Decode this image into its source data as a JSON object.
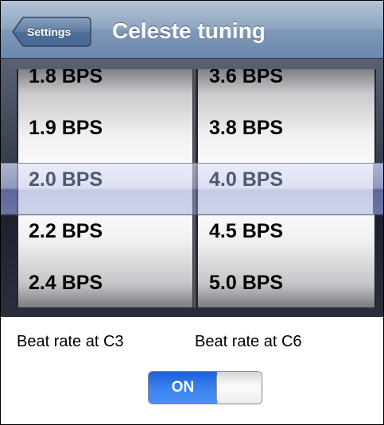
{
  "navbar": {
    "back_label": "Settings",
    "title": "Celeste tuning"
  },
  "picker": {
    "left_column": {
      "items": [
        "1.8 BPS",
        "1.9 BPS",
        "2.0 BPS",
        "2.2 BPS",
        "2.4 BPS"
      ],
      "selected": "2.0 BPS"
    },
    "right_column": {
      "items": [
        "3.6 BPS",
        "3.8 BPS",
        "4.0 BPS",
        "4.5 BPS",
        "5.0 BPS"
      ],
      "selected": "4.0 BPS"
    }
  },
  "labels": {
    "left": "Beat rate at C3",
    "right": "Beat rate at C6"
  },
  "toggle": {
    "state_label": "ON",
    "is_on": true,
    "on_color": "#3a82ef"
  },
  "colors": {
    "navbar": "#8ea5c1",
    "selection_bar": "#a6aedb"
  }
}
